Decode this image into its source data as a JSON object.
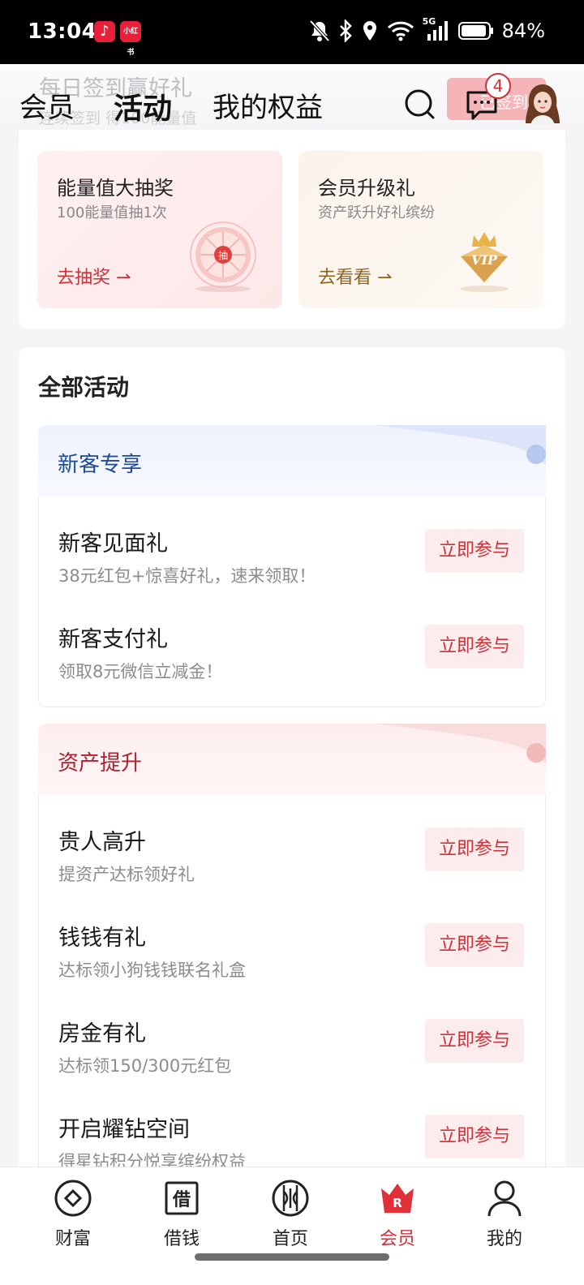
{
  "status_bar": {
    "time": "13:04",
    "battery": "84%",
    "network": "5G",
    "app_badges": [
      "music-app-icon",
      "xiaohongshu-app-icon"
    ],
    "xhs_label": "小红书",
    "icons": [
      "mute-bell-icon",
      "bluetooth-icon",
      "location-icon",
      "wifi-icon",
      "signal-icon",
      "battery-icon"
    ]
  },
  "header": {
    "ghost_title": "每日签到赢好礼",
    "ghost_subtitle": "连续签到 得100能量值",
    "tabs": [
      "会员",
      "活动",
      "我的权益"
    ],
    "active_tab": "活动",
    "checkin_label": "已签到",
    "message_count": "4"
  },
  "promos": [
    {
      "title": "能量值大抽奖",
      "subtitle": "100能量值抽1次",
      "link": "去抽奖 ⇀",
      "wheel_center": "抽"
    },
    {
      "title": "会员升级礼",
      "subtitle": "资产跃升好礼缤纷",
      "link": "去看看 ⇀",
      "badge_text": "VIP"
    }
  ],
  "all_activities": {
    "title": "全部活动",
    "sections": [
      {
        "title": "新客专享",
        "theme": "#1f4a9a",
        "items": [
          {
            "title": "新客见面礼",
            "subtitle": "38元红包+惊喜好礼，速来领取！",
            "button": "立即参与"
          },
          {
            "title": "新客支付礼",
            "subtitle": "领取8元微信立减金！",
            "button": "立即参与"
          }
        ]
      },
      {
        "title": "资产提升",
        "theme": "#b02030",
        "items": [
          {
            "title": "贵人高升",
            "subtitle": "提资产达标领好礼",
            "button": "立即参与"
          },
          {
            "title": "钱钱有礼",
            "subtitle": "达标领小狗钱钱联名礼盒",
            "button": "立即参与"
          },
          {
            "title": "房金有礼",
            "subtitle": "达标领150/300元红包",
            "button": "立即参与"
          },
          {
            "title": "开启耀钻空间",
            "subtitle": "得星钻积分悦享缤纷权益",
            "button": "立即参与"
          }
        ]
      }
    ]
  },
  "tabbar": {
    "items": [
      {
        "label": "财富",
        "icon": "wealth-icon"
      },
      {
        "label": "借钱",
        "icon": "borrow-icon",
        "glyph": "借"
      },
      {
        "label": "首页",
        "icon": "home-icon"
      },
      {
        "label": "会员",
        "icon": "member-crown-icon",
        "glyph": "R"
      },
      {
        "label": "我的",
        "icon": "profile-icon"
      }
    ],
    "active": "会员"
  },
  "colors": {
    "accent": "#d0303a",
    "accent_light": "#fdecec",
    "blue_section": "#1f4a9a",
    "gold": "#8a6420"
  }
}
